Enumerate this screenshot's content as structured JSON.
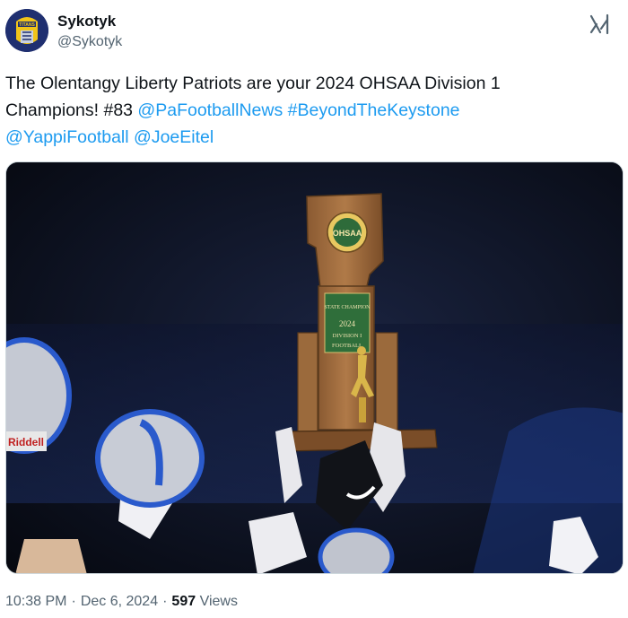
{
  "author": {
    "name": "Sykotyk",
    "handle": "@Sykotyk",
    "avatar_text": "TITANS"
  },
  "tweet": {
    "text_plain_1": "The Olentangy Liberty Patriots are your 2024 OHSAA Division 1 Champions! #83 ",
    "mention_1": "@PaFootballNews",
    "hashtag_1": "#BeyondTheKeystone",
    "mention_2": "@YappiFootball",
    "mention_3": "@JoeEitel"
  },
  "media": {
    "seal_text": "OHSAA",
    "plaque_line1": "STATE CHAMPION",
    "plaque_line2": "2024",
    "plaque_line3": "DIVISION I",
    "plaque_line4": "FOOTBALL",
    "helmet_text": "Riddell"
  },
  "meta": {
    "time": "10:38 PM",
    "date": "Dec 6, 2024",
    "views_count": "597",
    "views_label": "Views"
  },
  "colors": {
    "link": "#1d9bf0",
    "secondary_text": "#536471",
    "primary_text": "#0f1419"
  }
}
